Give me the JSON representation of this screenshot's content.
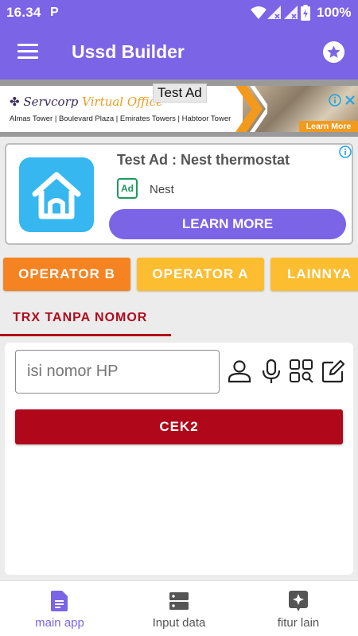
{
  "status_bar": {
    "time": "16.34",
    "notification_icon": "P",
    "battery_percent": "100%"
  },
  "app_bar": {
    "title": "Ussd Builder",
    "menu_icon": "menu-icon",
    "action_icon": "star-icon"
  },
  "banner_ad": {
    "brand": "Servcorp",
    "brand_tagline": "Virtual Office",
    "locations": "Almas Tower | Boulevard Plaza | Emirates Towers | Habtoor Tower",
    "label": "Test Ad",
    "cta": "Learn More"
  },
  "native_ad": {
    "title": "Test Ad : Nest thermostat",
    "badge": "Ad",
    "advertiser": "Nest",
    "cta": "LEARN MORE"
  },
  "operators": [
    {
      "label": "OPERATOR B",
      "color": "#f58321"
    },
    {
      "label": "OPERATOR A",
      "color": "#fdbd31"
    },
    {
      "label": "LAINNYA",
      "color": "#fdbd31"
    }
  ],
  "tab": {
    "label": "TRX TANPA NOMOR"
  },
  "form": {
    "phone_placeholder": "isi nomor HP",
    "submit_label": "CEK2"
  },
  "bottom_nav": [
    {
      "label": "main app",
      "icon": "document-icon",
      "active": true
    },
    {
      "label": "Input data",
      "icon": "storage-icon",
      "active": false
    },
    {
      "label": "fitur lain",
      "icon": "sparkle-icon",
      "active": false
    }
  ],
  "colors": {
    "primary": "#7b64e6",
    "accent_red": "#b00b1c",
    "orange": "#f58321",
    "yellow": "#fdbd31"
  }
}
